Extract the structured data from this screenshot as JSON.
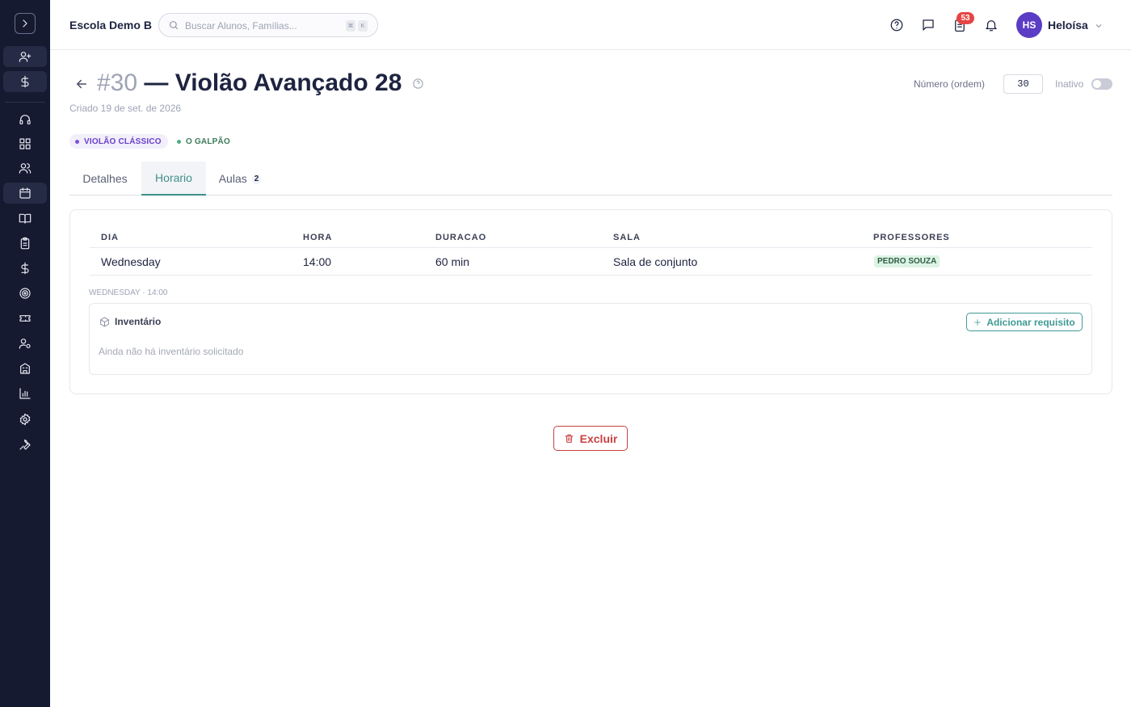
{
  "topbar": {
    "school_name": "Escola Demo B",
    "search_placeholder": "Buscar Alunos, Famílias...",
    "shortcut_keys": [
      "⌘",
      "K"
    ],
    "notification_count": "53",
    "user_initials": "HS",
    "user_name": "Heloísa"
  },
  "sidebar": {
    "items": [
      "toggle",
      "add-user",
      "dollar",
      "headset",
      "grid",
      "users",
      "calendar",
      "book",
      "clipboard",
      "dollar",
      "target",
      "ticket",
      "user-settings",
      "building",
      "chart",
      "gear",
      "wrench"
    ],
    "active": "calendar"
  },
  "header": {
    "number": "#30",
    "name": "— Violão Avançado 28",
    "created": "Criado 19 de set. de 2026",
    "order_label": "Número (ordem)",
    "order_value": "30",
    "inactive_label": "Inativo"
  },
  "tags": [
    {
      "label": "VIOLÃO CLÁSSICO",
      "color": "#6a3fc7"
    },
    {
      "label": "O GALPÃO",
      "color": "#3b7a5a"
    }
  ],
  "tabs": [
    {
      "label": "Detalhes"
    },
    {
      "label": "Horario",
      "active": true
    },
    {
      "label": "Aulas",
      "count": "2"
    }
  ],
  "schedule": {
    "headers": [
      "DIA",
      "HORA",
      "DURACAO",
      "SALA",
      "PROFESSORES"
    ],
    "rows": [
      {
        "day": "Wednesday",
        "time": "14:00",
        "duration": "60 min",
        "room": "Sala de conjunto",
        "teacher": "PEDRO SOUZA"
      }
    ],
    "slot_label": "WEDNESDAY · 14:00"
  },
  "inventory": {
    "title": "Inventário",
    "add_button": "Adicionar requisito",
    "empty_text": "Ainda não há inventário solicitado"
  },
  "actions": {
    "delete_label": "Excluir"
  },
  "colors": {
    "sidebar_bg": "#161a30",
    "accent": "#3e8f8a",
    "danger": "#c94040",
    "avatar": "#5b3cc4"
  }
}
